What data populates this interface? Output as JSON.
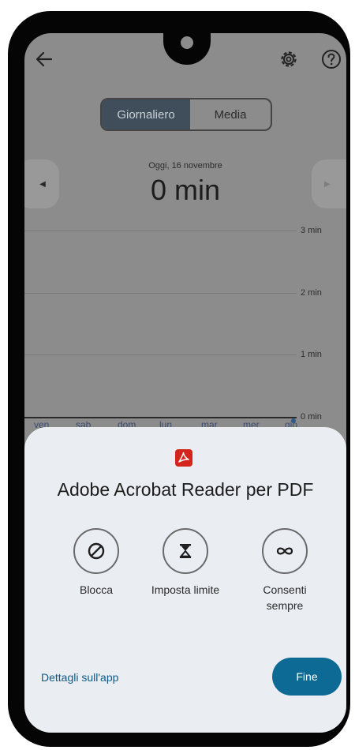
{
  "header": {
    "back_icon": "arrow-left-icon",
    "settings_icon": "gear-icon",
    "help_icon": "help-circle-icon"
  },
  "segmented": {
    "daily_label": "Giornaliero",
    "average_label": "Media",
    "selected": "Giornaliero"
  },
  "summary": {
    "date_label": "Oggi, 16 novembre",
    "total": "0 min"
  },
  "chart_data": {
    "type": "bar",
    "categories": [
      "ven",
      "sab",
      "dom",
      "lun",
      "mar",
      "mer",
      "gio"
    ],
    "values": [
      0,
      0,
      0,
      0,
      0,
      0,
      0
    ],
    "y_ticks": [
      "0 min",
      "1 min",
      "2 min",
      "3 min"
    ],
    "ylim": [
      0,
      3
    ],
    "grid": true,
    "highlighted_category": "gio"
  },
  "sheet": {
    "app_name": "Adobe Acrobat Reader per PDF",
    "app_icon": "acrobat-reader-icon",
    "actions": [
      {
        "label": "Blocca",
        "icon": "block-icon"
      },
      {
        "label": "Imposta limite",
        "icon": "hourglass-icon"
      },
      {
        "label_line1": "Consenti",
        "label_line2": "sempre",
        "icon": "infinity-icon"
      }
    ],
    "details_link": "Dettagli sull'app",
    "done_button": "Fine"
  },
  "colors": {
    "scrim": "#8c8c8c",
    "sheet_bg": "#eaeef3",
    "accent": "#0c6a94",
    "link": "#0e5a84",
    "acrobat_red": "#d3251c"
  }
}
